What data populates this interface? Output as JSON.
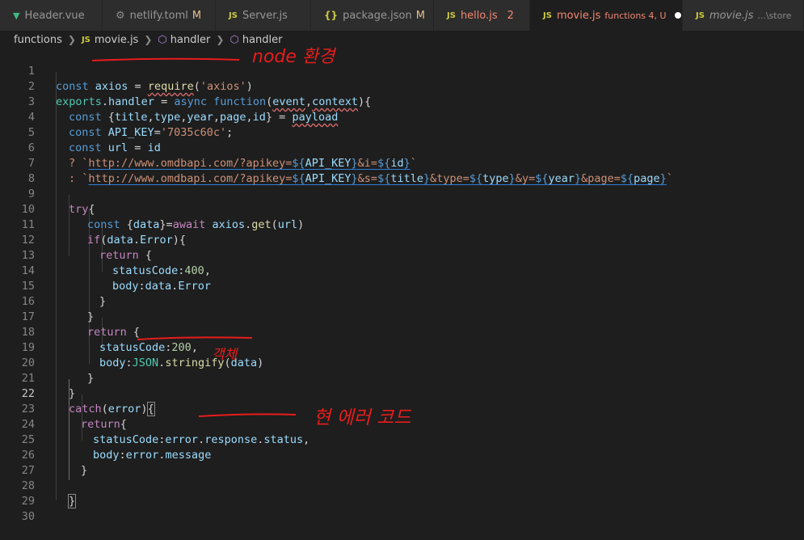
{
  "tabs": [
    {
      "icon": "vue-icon",
      "label": "Header.vue",
      "badge": "",
      "active": false
    },
    {
      "icon": "gear-icon",
      "label": "netlify.toml",
      "badge": "M",
      "active": false
    },
    {
      "icon": "js-icon",
      "label": "Server.js",
      "badge": "",
      "active": false
    },
    {
      "icon": "json-icon",
      "label": "package.json",
      "badge": "M",
      "active": false
    },
    {
      "icon": "js-icon",
      "label": "hello.js",
      "badge": "2",
      "active": false
    },
    {
      "icon": "js-icon",
      "label": "movie.js",
      "badge": "functions 4, U",
      "active": true
    },
    {
      "icon": "js-icon",
      "label": "movie.js",
      "badge": "...\\store",
      "active": false
    }
  ],
  "icon_glyphs": {
    "js": "JS",
    "json": "{}",
    "gear": "⚙",
    "vue": "▼"
  },
  "breadcrumb": {
    "items": [
      "functions",
      "movie.js",
      "handler",
      "handler"
    ]
  },
  "line_numbers": [
    "1",
    "2",
    "3",
    "4",
    "5",
    "6",
    "7",
    "8",
    "9",
    "10",
    "11",
    "12",
    "13",
    "14",
    "15",
    "16",
    "17",
    "18",
    "19",
    "20",
    "21",
    "22",
    "23",
    "24",
    "25",
    "26",
    "27",
    "28",
    "29",
    "30"
  ],
  "code": {
    "l1": [
      "const",
      " ",
      "axios",
      " = ",
      "require",
      "(",
      "'axios'",
      ")"
    ],
    "l2": [
      "exports",
      ".",
      "handler",
      " = ",
      "async",
      " ",
      "function",
      "(",
      "event",
      ",",
      "context",
      "){"
    ],
    "l3": [
      "const",
      " {",
      "title",
      ",",
      "type",
      ",",
      "year",
      ",",
      "page",
      ",",
      "id",
      "} = ",
      "payload"
    ],
    "l4": [
      "const",
      " ",
      "API_KEY",
      "=",
      "'7035c60c'",
      ";"
    ],
    "l5": [
      "const",
      " ",
      "url",
      " = ",
      "id"
    ],
    "l6": [
      "? `",
      "http://www.omdbapi.com/?apikey=",
      "${",
      "API_KEY",
      "}",
      "&i=",
      "${",
      "id",
      "}",
      "`"
    ],
    "l7": [
      ": `",
      "http://www.omdbapi.com/?apikey=",
      "${",
      "API_KEY",
      "}",
      "&s=",
      "${",
      "title",
      "}",
      "&type=",
      "${",
      "type",
      "}",
      "&y=",
      "${",
      "year",
      "}",
      "&page=",
      "${",
      "page",
      "}",
      "`"
    ],
    "l9": [
      "try",
      "{"
    ],
    "l10": [
      "const",
      " {",
      "data",
      "}=",
      "await",
      " ",
      "axios",
      ".",
      "get",
      "(",
      "url",
      ")"
    ],
    "l11": [
      "if",
      "(",
      "data",
      ".",
      "Error",
      "){"
    ],
    "l12": [
      "return",
      " {"
    ],
    "l13": [
      "statusCode",
      ":",
      "400",
      ","
    ],
    "l14": [
      "body",
      ":",
      "data",
      ".",
      "Error"
    ],
    "l15": [
      "}"
    ],
    "l16": [
      "}"
    ],
    "l17": [
      "return",
      " {"
    ],
    "l18": [
      "statusCode",
      ":",
      "200",
      ","
    ],
    "l19": [
      "body",
      ":",
      "JSON",
      ".",
      "stringify",
      "(",
      "data",
      ")"
    ],
    "l20": [
      "}"
    ],
    "l21": [
      "}"
    ],
    "l22": [
      "catch",
      "(",
      "error",
      ")",
      "{"
    ],
    "l23": [
      "return",
      "{"
    ],
    "l24": [
      "statusCode",
      ":",
      "error",
      ".",
      "response",
      ".",
      "status",
      ","
    ],
    "l25": [
      "body",
      ":",
      "error",
      ".",
      "message"
    ],
    "l26": [
      "}"
    ],
    "l28": [
      "}"
    ]
  },
  "annotations": {
    "a1": "node 환경",
    "a2": "객체",
    "a3": "현 에러 코드"
  },
  "colors": {
    "annotation_ink": "#e81c1c",
    "accent": "#ffffff"
  }
}
